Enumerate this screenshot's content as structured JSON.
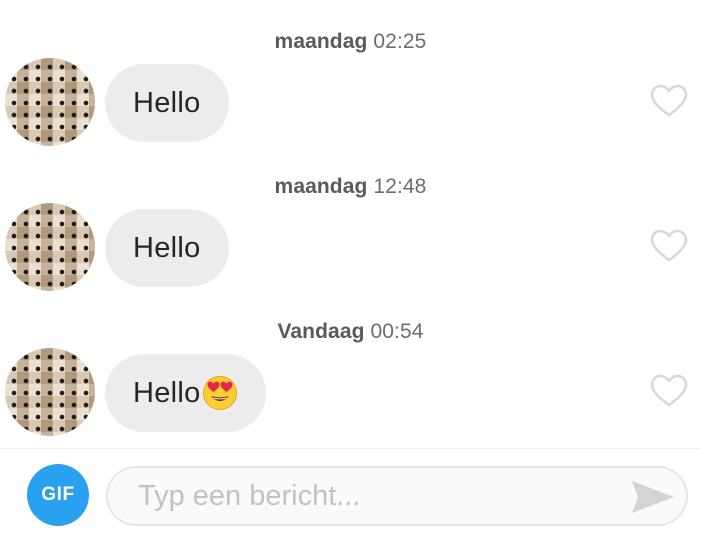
{
  "messages": [
    {
      "day": "maandag",
      "time": "02:25",
      "text": "Hello",
      "has_emoji": false,
      "liked": false
    },
    {
      "day": "maandag",
      "time": "12:48",
      "text": "Hello",
      "has_emoji": false,
      "liked": false
    },
    {
      "day": "Vandaag",
      "time": "00:54",
      "text": "Hello",
      "has_emoji": true,
      "emoji_icon": "heart-eyes-emoji-icon",
      "liked": false
    }
  ],
  "composer": {
    "gif_label": "GIF",
    "placeholder": "Typ een bericht...",
    "send_icon": "send-arrow-icon"
  },
  "colors": {
    "gif_button": "#2aa0f0",
    "bubble_bg": "#ececec",
    "heart_outline": "#d8d8d8",
    "send_arrow": "#d4d4d4"
  }
}
